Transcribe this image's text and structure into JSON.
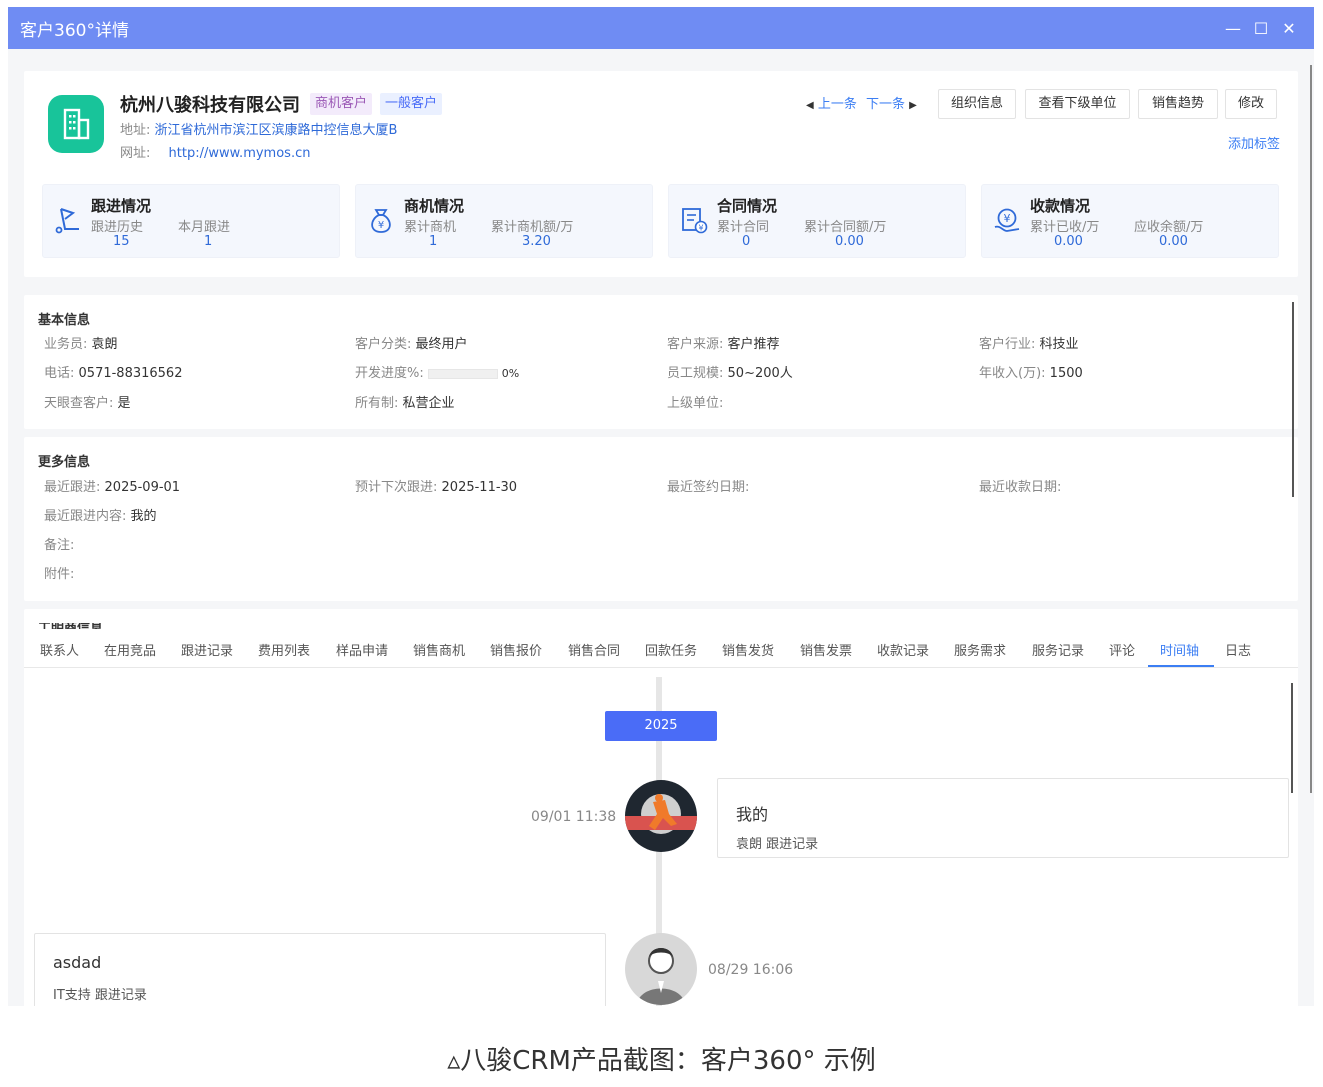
{
  "window": {
    "title": "客户360°详情",
    "accent": "#6f8cf3"
  },
  "header": {
    "company_name": "杭州八骏科技有限公司",
    "tags": [
      "商机客户",
      "一般客户"
    ],
    "address_label": "地址:",
    "address": "浙江省杭州市滨江区滨康路中控信息大厦B",
    "website_label": "网址:",
    "website": "http://www.mymos.cn",
    "prev": "上一条",
    "next": "下一条",
    "buttons": [
      "组织信息",
      "查看下级单位",
      "销售趋势",
      "修改"
    ],
    "add_tag": "添加标签"
  },
  "stats": [
    {
      "icon": "followup-icon",
      "title": "跟进情况",
      "items": [
        {
          "label": "跟进历史",
          "value": "15"
        },
        {
          "label": "本月跟进",
          "value": "1"
        }
      ]
    },
    {
      "icon": "money-bag-icon",
      "title": "商机情况",
      "items": [
        {
          "label": "累计商机",
          "value": "1"
        },
        {
          "label": "累计商机额/万",
          "value": "3.20"
        }
      ]
    },
    {
      "icon": "contract-icon",
      "title": "合同情况",
      "items": [
        {
          "label": "累计合同",
          "value": "0"
        },
        {
          "label": "累计合同额/万",
          "value": "0.00"
        }
      ]
    },
    {
      "icon": "payment-icon",
      "title": "收款情况",
      "items": [
        {
          "label": "累计已收/万",
          "value": "0.00"
        },
        {
          "label": "应收余额/万",
          "value": "0.00"
        }
      ]
    }
  ],
  "basic": {
    "title": "基本信息",
    "salesperson_k": "业务员:",
    "salesperson_v": "袁朗",
    "category_k": "客户分类:",
    "category_v": "最终用户",
    "source_k": "客户来源:",
    "source_v": "客户推荐",
    "industry_k": "客户行业:",
    "industry_v": "科技业",
    "phone_k": "电话:",
    "phone_v": "0571-88316562",
    "progress_k": "开发进度%:",
    "progress_v": "0%",
    "progress_fraction": 0,
    "staff_k": "员工规模:",
    "staff_v": "50~200人",
    "revenue_k": "年收入(万):",
    "revenue_v": "1500",
    "tianyan_k": "天眼查客户:",
    "tianyan_v": "是",
    "ownership_k": "所有制:",
    "ownership_v": "私营企业",
    "parent_k": "上级单位:",
    "parent_v": ""
  },
  "more": {
    "title": "更多信息",
    "last_follow_k": "最近跟进:",
    "last_follow_v": "2025-09-01",
    "next_follow_k": "预计下次跟进:",
    "next_follow_v": "2025-11-30",
    "last_sign_k": "最近签约日期:",
    "last_sign_v": "",
    "last_pay_k": "最近收款日期:",
    "last_pay_v": "",
    "last_content_k": "最近跟进内容:",
    "last_content_v": "我的",
    "remark_k": "备注:",
    "remark_v": "",
    "attach_k": "附件:",
    "attach_v": ""
  },
  "tabs_section": {
    "clipped_title": "工明商信息",
    "tabs": [
      "联系人",
      "在用竞品",
      "跟进记录",
      "费用列表",
      "样品申请",
      "销售商机",
      "销售报价",
      "销售合同",
      "回款任务",
      "销售发货",
      "销售发票",
      "收款记录",
      "服务需求",
      "服务记录",
      "评论",
      "时间轴",
      "日志"
    ],
    "active_tab": "时间轴"
  },
  "timeline": {
    "year": "2025",
    "entries": [
      {
        "time": "09/01 11:38",
        "title": "我的",
        "sub": "袁朗 跟进记录"
      },
      {
        "time": "08/29 16:06",
        "title": "asdad",
        "sub": "IT支持 跟进记录"
      }
    ]
  },
  "caption": "▵八骏CRM产品截图：客户360° 示例"
}
